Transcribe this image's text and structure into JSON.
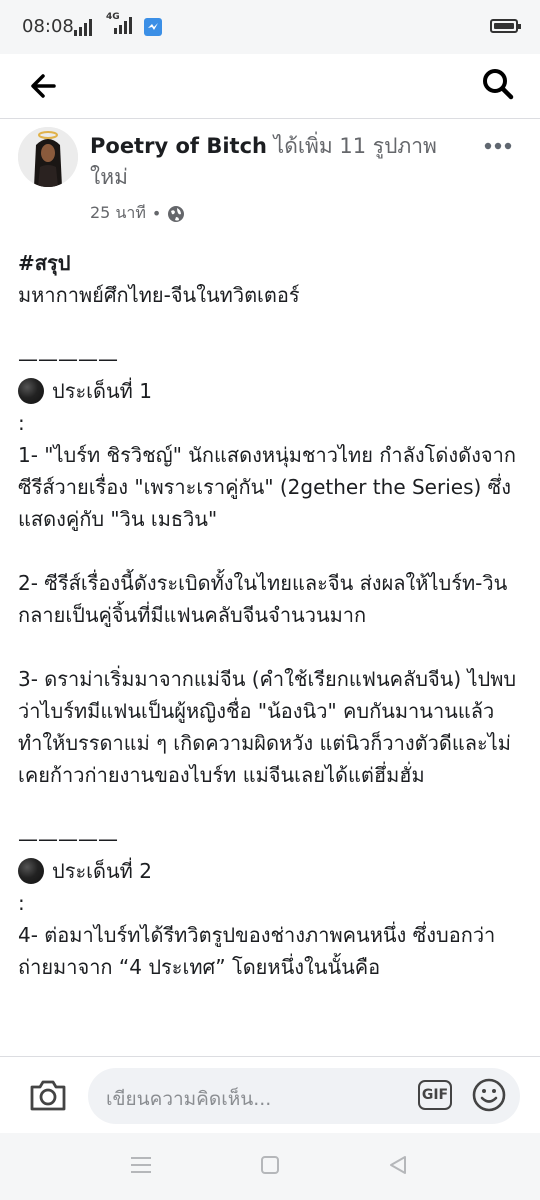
{
  "status_bar": {
    "time": "08:08",
    "network_label": "4G"
  },
  "header": {
    "back_icon": "arrow-left-icon",
    "search_icon": "search-icon"
  },
  "post": {
    "author": "Poetry of Bitch",
    "action": " ได้เพิ่ม 11 รูปภาพใหม่",
    "time": "25 นาที",
    "separator": "•",
    "privacy_icon": "globe-icon",
    "more_icon": "more-dots-icon",
    "body": {
      "hashtag": "#สรุป",
      "title": "มหากาพย์ศึกไทย-จีนในทวิตเตอร์",
      "divider1": "—————",
      "section1_heading": "ประเด็นที่ 1",
      "colon1": ":",
      "point1": "1- \"ไบร์ท ชิรวิชญ์\" นักแสดงหนุ่มชาวไทย กำลังโด่งดังจากซีรีส์วายเรื่อง \"เพราะเราคู่กัน\" (2gether the Series) ซึ่งแสดงคู่กับ \"วิน เมธวิน\"",
      "point2": "2- ซีรีส์เรื่องนี้ดังระเบิดทั้งในไทยและจีน ส่งผลให้ไบร์ท-วินกลายเป็นคู่จิ้นที่มีแฟนคลับจีนจำนวนมาก",
      "point3": "3- ดราม่าเริ่มมาจากแม่จีน (คำใช้เรียกแฟนคลับจีน) ไปพบว่าไบร์ทมีแฟนเป็นผู้หญิงชื่อ \"น้องนิว\" คบกันมานานแล้ว ทำให้บรรดาแม่ ๆ เกิดความผิดหวัง แต่นิวก็วางตัวดีและไม่เคยก้าวก่ายงานของไบร์ท แม่จีนเลยได้แต่ฮึ่มฮั่ม",
      "divider2": "—————",
      "section2_heading": "ประเด็นที่ 2",
      "colon2": ":",
      "point4": "4- ต่อมาไบร์ทได้รีทวิตรูปของช่างภาพคนหนึ่ง ซึ่งบอกว่าถ่ายมาจาก “4 ประเทศ” โดยหนึ่งในนั้นคือ"
    }
  },
  "comment_bar": {
    "camera_icon": "camera-icon",
    "placeholder": "เขียนความคิดเห็น...",
    "gif_label": "GIF",
    "emoji_icon": "emoji-icon"
  },
  "nav_bar": {
    "menu_icon": "menu-icon",
    "home_icon": "home-square-icon",
    "back_icon": "back-triangle-icon"
  }
}
